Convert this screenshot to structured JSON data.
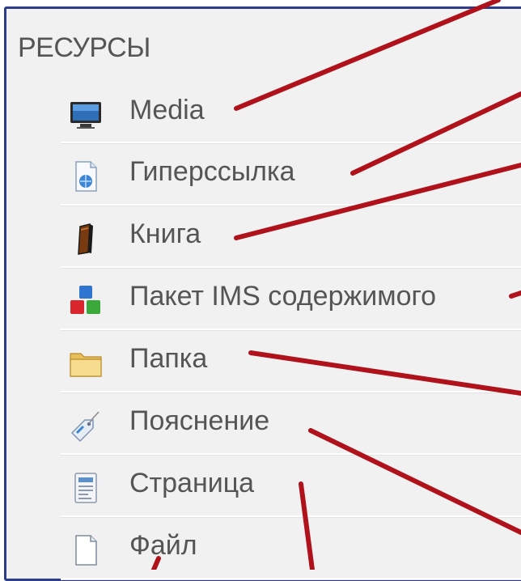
{
  "section": {
    "title": "РЕСУРСЫ"
  },
  "resources": [
    {
      "label": "Media",
      "icon": "monitor-icon"
    },
    {
      "label": "Гиперссылка",
      "icon": "url-document-icon"
    },
    {
      "label": "Книга",
      "icon": "book-icon"
    },
    {
      "label": "Пакет IMS содержимого",
      "icon": "ims-package-blocks-icon"
    },
    {
      "label": "Папка",
      "icon": "folder-icon"
    },
    {
      "label": "Пояснение",
      "icon": "tag-label-icon"
    },
    {
      "label": "Страница",
      "icon": "page-document-icon"
    },
    {
      "label": "Файл",
      "icon": "file-icon"
    }
  ],
  "colors": {
    "frame_border": "#2d3c8a",
    "panel_bg": "#f1f1f1",
    "text": "#555555",
    "callout_line": "#b0121c"
  }
}
